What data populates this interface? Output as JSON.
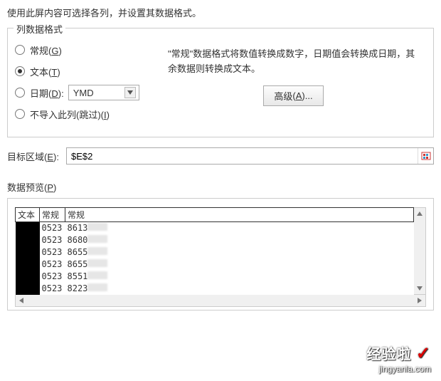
{
  "instruction": "使用此屏内容可选择各列，并设置其数据格式。",
  "formatGroup": {
    "legend": "列数据格式",
    "options": {
      "general": {
        "label": "常规",
        "hotkey": "G"
      },
      "text": {
        "label": "文本",
        "hotkey": "T"
      },
      "date": {
        "label": "日期",
        "hotkey": "D"
      },
      "skip": {
        "label": "不导入此列(跳过)",
        "hotkey": "I"
      }
    },
    "selected": "text",
    "dateFormat": "YMD",
    "description": "\"常规\"数据格式将数值转换成数字，日期值会转换成日期，其余数据则转换成文本。",
    "advanced": {
      "label": "高级",
      "hotkey": "A",
      "suffix": "..."
    }
  },
  "target": {
    "label": "目标区域",
    "hotkey": "E",
    "value": "$E$2"
  },
  "preview": {
    "label": "数据预览",
    "hotkey": "P",
    "headers": [
      "文本",
      "常规",
      "常规"
    ],
    "rows": [
      {
        "c1": "",
        "c2": "0523",
        "c3": "8613"
      },
      {
        "c1": "",
        "c2": "0523",
        "c3": "8680"
      },
      {
        "c1": "",
        "c2": "0523",
        "c3": "8655"
      },
      {
        "c1": "",
        "c2": "0523",
        "c3": "8655"
      },
      {
        "c1": "",
        "c2": "0523",
        "c3": "8551"
      },
      {
        "c1": "",
        "c2": "0523",
        "c3": "8223"
      }
    ]
  },
  "watermark": {
    "title": "经验啦",
    "url": "jingyanla.com"
  }
}
